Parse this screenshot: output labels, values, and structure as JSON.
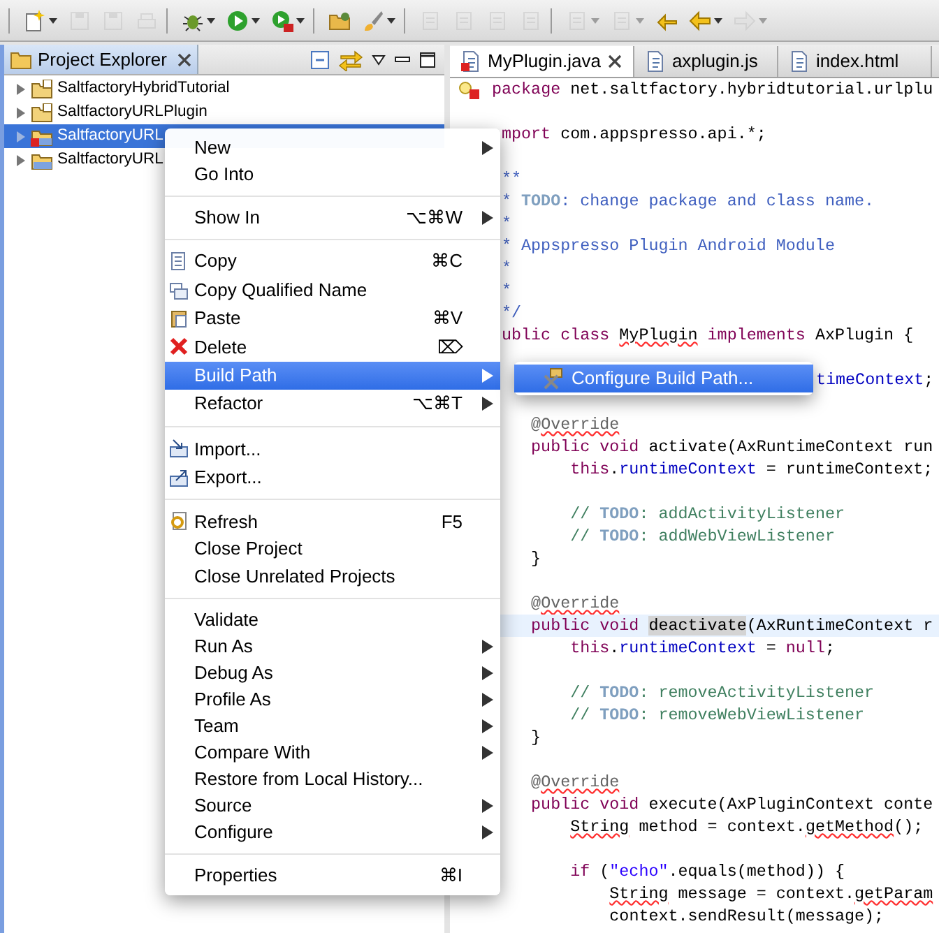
{
  "toolbar": {
    "groups": [
      [
        {
          "disabled": false,
          "dropdown": true
        },
        {
          "disabled": true,
          "dropdown": false
        },
        {
          "disabled": true,
          "dropdown": false
        },
        {
          "disabled": true,
          "dropdown": false
        }
      ],
      [
        {
          "disabled": false,
          "dropdown": true
        },
        {
          "disabled": false,
          "dropdown": true
        },
        {
          "disabled": false,
          "dropdown": true
        }
      ],
      [
        {
          "disabled": false,
          "dropdown": false
        },
        {
          "disabled": false,
          "dropdown": true
        }
      ],
      [
        {
          "disabled": true,
          "dropdown": false
        },
        {
          "disabled": true,
          "dropdown": false
        },
        {
          "disabled": true,
          "dropdown": false
        },
        {
          "disabled": true,
          "dropdown": false
        }
      ],
      [
        {
          "disabled": true,
          "dropdown": true
        },
        {
          "disabled": true,
          "dropdown": true
        },
        {
          "disabled": false,
          "dropdown": false
        },
        {
          "disabled": false,
          "dropdown": true
        },
        {
          "disabled": true,
          "dropdown": true
        }
      ]
    ]
  },
  "project_explorer": {
    "title": "Project Explorer",
    "tree": [
      {
        "label": "SaltfactoryHybridTutorial",
        "selected": false,
        "error": false
      },
      {
        "label": "SaltfactoryURLPlugin",
        "selected": false,
        "error": false
      },
      {
        "label": "SaltfactoryURL",
        "selected": true,
        "error": true
      },
      {
        "label": "SaltfactoryURL",
        "selected": false,
        "error": false
      }
    ]
  },
  "editor": {
    "tabs": [
      {
        "label": "MyPlugin.java",
        "selected": true,
        "error": true
      },
      {
        "label": "axplugin.js",
        "selected": false,
        "error": false
      },
      {
        "label": "index.html",
        "selected": false,
        "error": false
      }
    ],
    "lines": [
      {
        "kind": "full",
        "current": false,
        "segments": [
          {
            "text": "package",
            "kind": "keyword"
          },
          {
            "text": " net.saltfactory.hybridtutorial.urlplu",
            "kind": "plain"
          }
        ]
      },
      {
        "kind": "blank",
        "current": false
      },
      {
        "kind": "clipped",
        "current": false,
        "segments": [
          {
            "text": "mport",
            "kind": "keyword"
          },
          {
            "text": " com.appspresso.api.*;",
            "kind": "plain"
          }
        ]
      },
      {
        "kind": "blank",
        "current": false
      },
      {
        "kind": "clipped",
        "current": false,
        "segments": [
          {
            "text": "**",
            "kind": "doc"
          }
        ]
      },
      {
        "kind": "clipped",
        "current": false,
        "segments": [
          {
            "text": "* ",
            "kind": "doc"
          },
          {
            "text": "TODO",
            "kind": "tag"
          },
          {
            "text": ": change package and class name.",
            "kind": "doc"
          }
        ]
      },
      {
        "kind": "clipped",
        "current": false,
        "segments": [
          {
            "text": "*",
            "kind": "doc"
          }
        ]
      },
      {
        "kind": "clipped",
        "current": false,
        "segments": [
          {
            "text": "* Appspresso Plugin Android Module",
            "kind": "doc"
          }
        ]
      },
      {
        "kind": "clipped",
        "current": false,
        "segments": [
          {
            "text": "*",
            "kind": "doc"
          }
        ]
      },
      {
        "kind": "clipped",
        "current": false,
        "segments": [
          {
            "text": "*",
            "kind": "doc"
          }
        ]
      },
      {
        "kind": "clipped",
        "current": false,
        "segments": [
          {
            "text": "*/",
            "kind": "doc"
          }
        ]
      },
      {
        "kind": "clipped",
        "current": false,
        "segments": [
          {
            "text": "ublic class ",
            "kind": "keyword"
          },
          {
            "text": "MyPlugin",
            "kind": "plain_error"
          },
          {
            "text": " implements",
            "kind": "keyword"
          },
          {
            "text": " AxPlugin {",
            "kind": "plain"
          }
        ]
      },
      {
        "kind": "blank",
        "current": false
      },
      {
        "kind": "under_submenu",
        "current": false,
        "segments": [
          {
            "text": "timeContext",
            "kind": "field"
          },
          {
            "text": ";",
            "kind": "plain"
          }
        ]
      },
      {
        "kind": "blank",
        "current": false
      },
      {
        "kind": "clipped",
        "current": false,
        "segments": [
          {
            "text": "   @",
            "kind": "annotation"
          },
          {
            "text": "Override",
            "kind": "annotation_error"
          }
        ]
      },
      {
        "kind": "clipped",
        "current": false,
        "segments": [
          {
            "text": "   public void",
            "kind": "keyword"
          },
          {
            "text": " activate(AxRuntimeContext run",
            "kind": "plain"
          }
        ]
      },
      {
        "kind": "clipped",
        "current": false,
        "segments": [
          {
            "text": "       this",
            "kind": "keyword"
          },
          {
            "text": ".",
            "kind": "plain"
          },
          {
            "text": "runtimeContext",
            "kind": "field"
          },
          {
            "text": " = runtimeContext;",
            "kind": "plain"
          }
        ]
      },
      {
        "kind": "blank",
        "current": false
      },
      {
        "kind": "clipped",
        "current": false,
        "segments": [
          {
            "text": "       // ",
            "kind": "comment"
          },
          {
            "text": "TODO",
            "kind": "tag"
          },
          {
            "text": ": addActivityListener",
            "kind": "comment"
          }
        ]
      },
      {
        "kind": "clipped",
        "current": false,
        "segments": [
          {
            "text": "       // ",
            "kind": "comment"
          },
          {
            "text": "TODO",
            "kind": "tag"
          },
          {
            "text": ": addWebViewListener",
            "kind": "comment"
          }
        ]
      },
      {
        "kind": "clipped",
        "current": false,
        "segments": [
          {
            "text": "   }",
            "kind": "plain"
          }
        ]
      },
      {
        "kind": "blank",
        "current": false
      },
      {
        "kind": "clipped",
        "current": false,
        "segments": [
          {
            "text": "   @",
            "kind": "annotation"
          },
          {
            "text": "Override",
            "kind": "annotation_error"
          }
        ]
      },
      {
        "kind": "clipped",
        "current": true,
        "segments": [
          {
            "text": "   public void ",
            "kind": "keyword"
          },
          {
            "text": "deactivate",
            "kind": "occurrence"
          },
          {
            "text": "(AxRuntimeContext r",
            "kind": "plain"
          }
        ]
      },
      {
        "kind": "clipped",
        "current": false,
        "segments": [
          {
            "text": "       this",
            "kind": "keyword"
          },
          {
            "text": ".",
            "kind": "plain"
          },
          {
            "text": "runtimeContext",
            "kind": "field"
          },
          {
            "text": " = ",
            "kind": "plain"
          },
          {
            "text": "null",
            "kind": "keyword"
          },
          {
            "text": ";",
            "kind": "plain"
          }
        ]
      },
      {
        "kind": "blank",
        "current": false
      },
      {
        "kind": "clipped",
        "current": false,
        "segments": [
          {
            "text": "       // ",
            "kind": "comment"
          },
          {
            "text": "TODO",
            "kind": "tag"
          },
          {
            "text": ": removeActivityListener",
            "kind": "comment"
          }
        ]
      },
      {
        "kind": "clipped",
        "current": false,
        "segments": [
          {
            "text": "       // ",
            "kind": "comment"
          },
          {
            "text": "TODO",
            "kind": "tag"
          },
          {
            "text": ": removeWebViewListener",
            "kind": "comment"
          }
        ]
      },
      {
        "kind": "clipped",
        "current": false,
        "segments": [
          {
            "text": "   }",
            "kind": "plain"
          }
        ]
      },
      {
        "kind": "blank",
        "current": false
      },
      {
        "kind": "clipped",
        "current": false,
        "segments": [
          {
            "text": "   @",
            "kind": "annotation"
          },
          {
            "text": "Override",
            "kind": "annotation_error"
          }
        ]
      },
      {
        "kind": "clipped",
        "current": false,
        "segments": [
          {
            "text": "   public void",
            "kind": "keyword"
          },
          {
            "text": " execute(AxPluginContext conte",
            "kind": "plain"
          }
        ]
      },
      {
        "kind": "clipped",
        "current": false,
        "segments": [
          {
            "text": "       String",
            "kind": "plain_error"
          },
          {
            "text": " method = context.",
            "kind": "plain"
          },
          {
            "text": "getMethod",
            "kind": "plain_error"
          },
          {
            "text": "();",
            "kind": "plain"
          }
        ]
      },
      {
        "kind": "blank",
        "current": false
      },
      {
        "kind": "clipped",
        "current": false,
        "segments": [
          {
            "text": "       if",
            "kind": "keyword"
          },
          {
            "text": " (",
            "kind": "plain"
          },
          {
            "text": "\"echo\"",
            "kind": "string"
          },
          {
            "text": ".equals(method)) {",
            "kind": "plain"
          }
        ]
      },
      {
        "kind": "clipped",
        "current": false,
        "segments": [
          {
            "text": "           String",
            "kind": "plain_error"
          },
          {
            "text": " message = context.",
            "kind": "plain"
          },
          {
            "text": "getParam",
            "kind": "plain_error"
          }
        ]
      },
      {
        "kind": "full",
        "current": false,
        "segments": [
          {
            "text": "            context.sendResult(message);",
            "kind": "plain"
          }
        ]
      }
    ]
  },
  "context_menu": {
    "groups": [
      [
        {
          "label": "New",
          "submenu": true,
          "selected": false
        },
        {
          "label": "Go Into",
          "submenu": false,
          "selected": false
        }
      ],
      [
        {
          "label": "Show In",
          "shortcut": "⌥⌘W",
          "submenu": true,
          "selected": false
        }
      ],
      [
        {
          "label": "Copy",
          "shortcut": "⌘C",
          "submenu": false,
          "selected": false
        },
        {
          "label": "Copy Qualified Name",
          "submenu": false,
          "selected": false
        },
        {
          "label": "Paste",
          "shortcut": "⌘V",
          "submenu": false,
          "selected": false
        },
        {
          "label": "Delete",
          "shortcut": "⌦",
          "submenu": false,
          "selected": false
        },
        {
          "label": "Build Path",
          "submenu": true,
          "selected": true
        },
        {
          "label": "Refactor",
          "shortcut": "⌥⌘T",
          "submenu": true,
          "selected": false
        }
      ],
      [
        {
          "label": "Import...",
          "submenu": false,
          "selected": false
        },
        {
          "label": "Export...",
          "submenu": false,
          "selected": false
        }
      ],
      [
        {
          "label": "Refresh",
          "shortcut": "F5",
          "submenu": false,
          "selected": false
        },
        {
          "label": "Close Project",
          "submenu": false,
          "selected": false
        },
        {
          "label": "Close Unrelated Projects",
          "submenu": false,
          "selected": false
        }
      ],
      [
        {
          "label": "Validate",
          "submenu": false,
          "selected": false
        },
        {
          "label": "Run As",
          "submenu": true,
          "selected": false
        },
        {
          "label": "Debug As",
          "submenu": true,
          "selected": false
        },
        {
          "label": "Profile As",
          "submenu": true,
          "selected": false
        },
        {
          "label": "Team",
          "submenu": true,
          "selected": false
        },
        {
          "label": "Compare With",
          "submenu": true,
          "selected": false
        },
        {
          "label": "Restore from Local History...",
          "submenu": false,
          "selected": false
        },
        {
          "label": "Source",
          "submenu": true,
          "selected": false
        },
        {
          "label": "Configure",
          "submenu": true,
          "selected": false
        }
      ],
      [
        {
          "label": "Properties",
          "shortcut": "⌘I",
          "submenu": false,
          "selected": false
        }
      ]
    ]
  },
  "submenu": {
    "items": [
      {
        "label": "Configure Build Path...",
        "selected": true
      }
    ]
  }
}
